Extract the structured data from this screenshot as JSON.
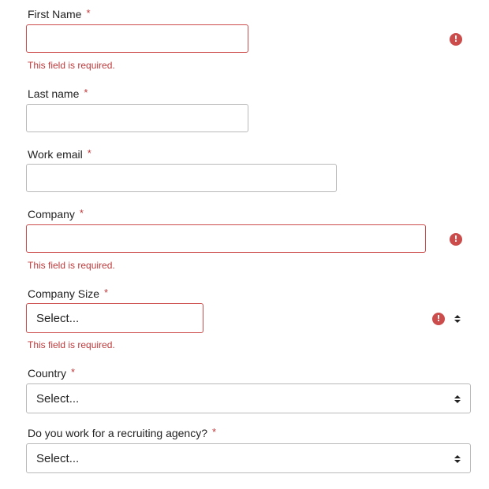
{
  "required_marker": "*",
  "error_icon_glyph": "!",
  "colors": {
    "error": "#cc4b4b",
    "border": "#b9b9b9",
    "label": "#222222"
  },
  "fields": {
    "first_name": {
      "label": "First Name",
      "value": "",
      "error": "This field is required."
    },
    "last_name": {
      "label": "Last name",
      "value": ""
    },
    "work_email": {
      "label": "Work email",
      "value": ""
    },
    "company": {
      "label": "Company",
      "value": "",
      "error": "This field is required."
    },
    "company_size": {
      "label": "Company Size",
      "selected": "Select...",
      "error": "This field is required."
    },
    "country": {
      "label": "Country",
      "selected": "Select..."
    },
    "recruiting_agency": {
      "label": "Do you work for a recruiting agency?",
      "selected": "Select..."
    }
  }
}
